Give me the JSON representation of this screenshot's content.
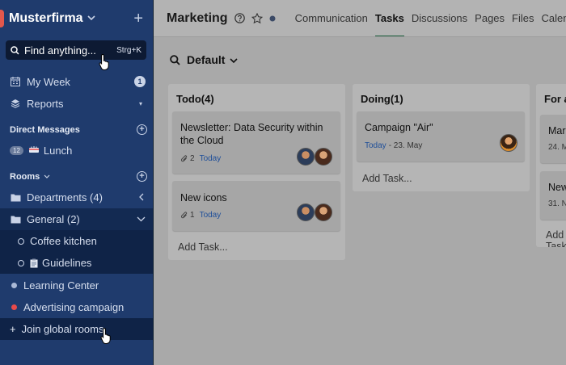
{
  "sidebar": {
    "org_name": "Musterfirma",
    "search": {
      "placeholder": "Find anything...",
      "shortcut": "Strg+K"
    },
    "nav": [
      {
        "label": "My Week",
        "icon": "calendar-icon",
        "badge": "1"
      },
      {
        "label": "Reports",
        "icon": "layers-icon"
      }
    ],
    "direct_messages": {
      "title": "Direct Messages",
      "items": [
        {
          "label": "Lunch",
          "count": "12",
          "icon": "plate-icon"
        }
      ]
    },
    "rooms": {
      "title": "Rooms",
      "items": [
        {
          "label": "Departments (4)",
          "icon": "folder-icon"
        },
        {
          "label": "General (2)",
          "icon": "folder-icon"
        },
        {
          "label": "Coffee kitchen"
        },
        {
          "label": "Guidelines",
          "icon": "clipboard-icon"
        },
        {
          "label": "Learning Center",
          "dot_color": "#aab9d6"
        },
        {
          "label": "Advertising campaign",
          "dot_color": "#e84a4a"
        }
      ]
    },
    "join_label": "Join global rooms"
  },
  "header": {
    "title": "Marketing",
    "tabs": [
      "Communication",
      "Tasks",
      "Discussions",
      "Pages",
      "Files",
      "Calendar"
    ],
    "active_tab": "Tasks"
  },
  "board": {
    "view_label": "Default",
    "add_task_label": "Add Task...",
    "columns": [
      {
        "title": "Todo(4)",
        "cards": [
          {
            "title_lines": [
              "Newsletter: Data Security within",
              "the Cloud"
            ],
            "attachments": "2",
            "due": "Today"
          },
          {
            "title_lines": [
              "New icons"
            ],
            "attachments": "1",
            "due": "Today"
          }
        ]
      },
      {
        "title": "Doing(1)",
        "cards": [
          {
            "title_lines": [
              "Campaign \"Air\""
            ],
            "due": "Today",
            "due_suffix": "- 23. May"
          }
        ]
      },
      {
        "title": "For a",
        "cards": [
          {
            "title_lines": [
              "Mar"
            ],
            "due_suffix": "24. M"
          },
          {
            "title_lines": [
              "New"
            ],
            "due_suffix": "31. N"
          }
        ]
      }
    ]
  },
  "colors": {
    "sidebar_bg": "#1f3b6d",
    "accent_red": "#e2574c",
    "tab_underline": "#1b5e3b",
    "today_blue": "#1f4f99"
  }
}
